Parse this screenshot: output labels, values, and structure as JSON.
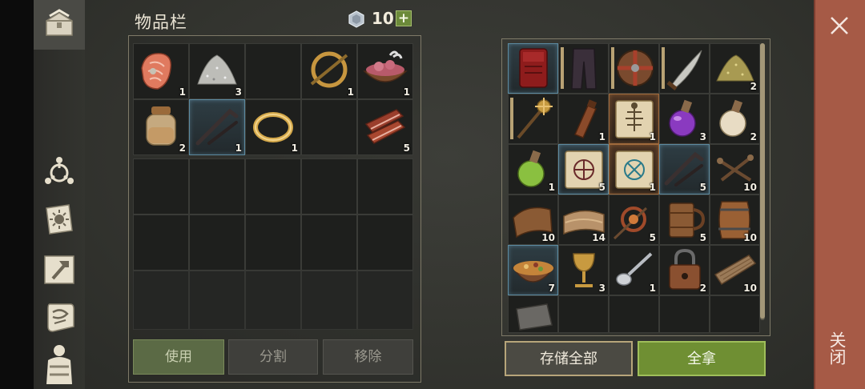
{
  "inventory": {
    "title": "物品栏",
    "currency_count": "10",
    "plus_label": "+",
    "slots": [
      {
        "name": "raw-fish-steak",
        "count": "1"
      },
      {
        "name": "salt-pile",
        "count": "3"
      },
      {
        "name": "empty",
        "count": ""
      },
      {
        "name": "ring-brooch",
        "count": "1"
      },
      {
        "name": "raw-meat-bowl",
        "count": "1"
      },
      {
        "name": "fermented-jar",
        "count": "2"
      },
      {
        "name": "iron-crowbar",
        "count": "1"
      },
      {
        "name": "gold-ring",
        "count": "1"
      },
      {
        "name": "empty",
        "count": ""
      },
      {
        "name": "bacon-strips",
        "count": "5"
      }
    ],
    "buttons": {
      "use": "使用",
      "split": "分割",
      "remove": "移除"
    }
  },
  "storage": {
    "slots": [
      {
        "name": "red-backpack",
        "count": ""
      },
      {
        "name": "dark-pants",
        "count": ""
      },
      {
        "name": "round-shield",
        "count": ""
      },
      {
        "name": "scimitar",
        "count": ""
      },
      {
        "name": "seed-pile",
        "count": "2"
      },
      {
        "name": "spiked-mace",
        "count": ""
      },
      {
        "name": "leather-flask",
        "count": "1"
      },
      {
        "name": "skeleton-scroll",
        "count": "1"
      },
      {
        "name": "purple-potion",
        "count": "3"
      },
      {
        "name": "milk-potion",
        "count": "2"
      },
      {
        "name": "green-potion",
        "count": "1"
      },
      {
        "name": "rune-scroll-a",
        "count": "5"
      },
      {
        "name": "rune-scroll-b",
        "count": "1"
      },
      {
        "name": "iron-crowbar",
        "count": "5"
      },
      {
        "name": "nails",
        "count": "10"
      },
      {
        "name": "leather-scrap",
        "count": "10"
      },
      {
        "name": "cloth-roll",
        "count": "14"
      },
      {
        "name": "fire-spit",
        "count": "5"
      },
      {
        "name": "wooden-mug",
        "count": "5"
      },
      {
        "name": "barrel",
        "count": "10"
      },
      {
        "name": "stew-bowl",
        "count": "7"
      },
      {
        "name": "golden-goblet",
        "count": "3"
      },
      {
        "name": "silver-spoon",
        "count": "1"
      },
      {
        "name": "padlock",
        "count": "2"
      },
      {
        "name": "wood-plank",
        "count": "10"
      },
      {
        "name": "stone-block",
        "count": ""
      }
    ],
    "buttons": {
      "store_all": "存储全部",
      "take_all": "全拿"
    }
  },
  "close": {
    "label": "关闭",
    "icon": "close-icon"
  },
  "sidebar": {
    "icons": [
      "chest-icon",
      "guild-emblem-icon",
      "quest-book-icon",
      "hammer-map-icon",
      "scroll-icon",
      "character-icon"
    ]
  }
}
